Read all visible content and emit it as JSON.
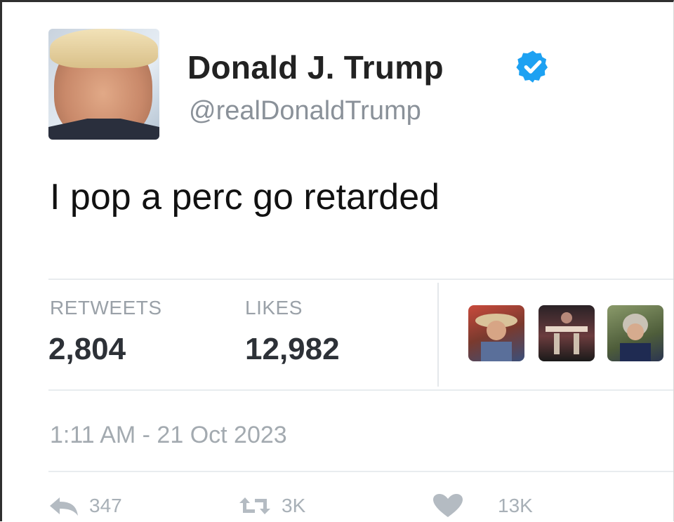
{
  "author": {
    "name": "Donald J. Trump",
    "handle": "@realDonaldTrump",
    "verified_icon": "verified-badge-icon",
    "verified_color": "#1da1f2"
  },
  "tweet": {
    "text": "I pop a perc go retarded"
  },
  "stats": {
    "retweets_label": "RETWEETS",
    "retweets_value": "2,804",
    "likes_label": "LIKES",
    "likes_value": "12,982"
  },
  "timestamp": "1:11 AM - 21 Oct 2023",
  "actions": {
    "reply_icon": "reply-icon",
    "reply_count": "347",
    "retweet_icon": "retweet-icon",
    "retweet_count": "3K",
    "like_icon": "heart-icon",
    "like_count": "13K"
  }
}
